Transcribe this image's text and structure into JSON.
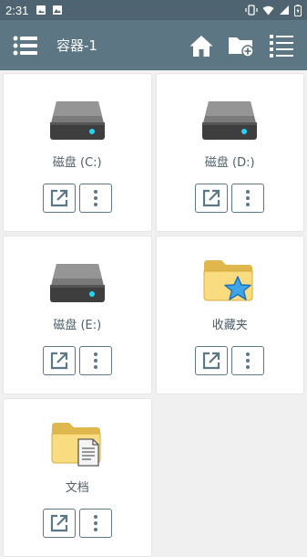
{
  "status_bar": {
    "time": "2:31"
  },
  "app_bar": {
    "title": "容器-1"
  },
  "items": [
    {
      "label": "磁盘 (C:)",
      "icon": "hard-drive-icon"
    },
    {
      "label": "磁盘 (D:)",
      "icon": "hard-drive-icon"
    },
    {
      "label": "磁盘 (E:)",
      "icon": "hard-drive-icon"
    },
    {
      "label": "收藏夹",
      "icon": "favorites-folder-icon"
    },
    {
      "label": "文档",
      "icon": "documents-folder-icon"
    }
  ],
  "colors": {
    "status_bar": "#4e6470",
    "app_bar": "#5d7684",
    "accent": "#5c7785",
    "background": "#f0f0f0"
  }
}
